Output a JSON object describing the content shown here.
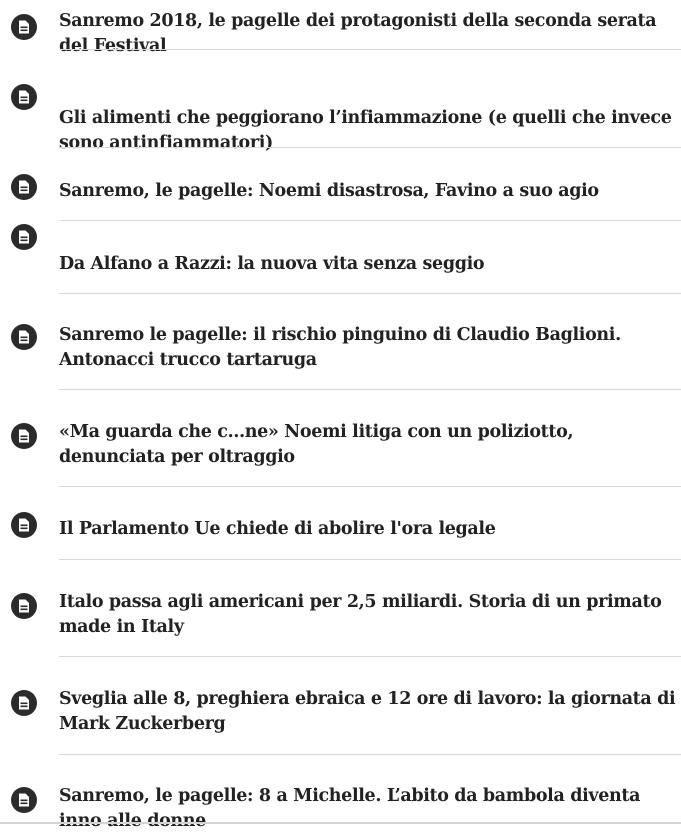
{
  "articles": [
    {
      "title": "Sanremo 2018, le pagelle dei protagonisti della seconda serata del Festival",
      "icon": "article-icon"
    },
    {
      "title": "Gli alimenti che peggiorano l’infiammazione (e quelli che invece sono antinfiammatori)",
      "icon": "article-icon"
    },
    {
      "title": "Sanremo, le pagelle: Noemi disastrosa, Favino a suo agio",
      "icon": "article-icon"
    },
    {
      "title": "Da Alfano a Razzi: la nuova vita senza seggio",
      "icon": "article-icon"
    },
    {
      "title": "Sanremo le pagelle: il rischio pinguino di Claudio Baglioni. Antonacci trucco tartaruga",
      "icon": "article-icon"
    },
    {
      "title": "«Ma guarda che c…ne» Noemi litiga con un poliziotto, denunciata per oltraggio",
      "icon": "article-icon"
    },
    {
      "title": "Il Parlamento Ue chiede di abolire l'ora legale",
      "icon": "article-icon"
    },
    {
      "title": "Italo passa agli americani per 2,5 miliardi. Storia di un primato made in Italy",
      "icon": "article-icon"
    },
    {
      "title": "Sveglia alle 8, preghiera ebraica e 12 ore di lavoro: la giornata di Mark Zuckerberg",
      "icon": "article-icon"
    },
    {
      "title": "Sanremo, le pagelle: 8 a Michelle. L’abito da bambola diventa inno alle donne",
      "icon": "article-icon"
    }
  ],
  "colors": {
    "text": "#222222",
    "icon": "#2b2b2b",
    "divider": "#d9d9d9"
  }
}
